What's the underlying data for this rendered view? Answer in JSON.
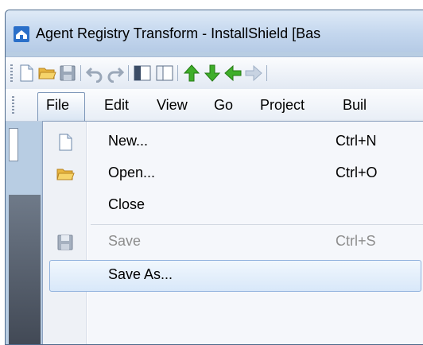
{
  "window": {
    "title": "Agent Registry Transform - InstallShield [Bas"
  },
  "toolbar": {
    "buttons": [
      "new-icon",
      "open-folder-icon",
      "save-icon",
      "undo-icon",
      "redo-icon",
      "panel-left-icon",
      "panel-right-icon",
      "arrow-up-icon",
      "arrow-down-icon",
      "arrow-left-icon",
      "arrow-right-icon"
    ]
  },
  "menubar": {
    "items": [
      {
        "label": "File"
      },
      {
        "label": "Edit"
      },
      {
        "label": "View"
      },
      {
        "label": "Go"
      },
      {
        "label": "Project"
      },
      {
        "label": "Buil"
      }
    ]
  },
  "file_menu": {
    "items": [
      {
        "label": "New...",
        "shortcut": "Ctrl+N",
        "icon": "new-file-icon",
        "enabled": true
      },
      {
        "label": "Open...",
        "shortcut": "Ctrl+O",
        "icon": "open-folder-icon",
        "enabled": true
      },
      {
        "label": "Close",
        "shortcut": "",
        "icon": "",
        "enabled": true
      },
      {
        "label": "Save",
        "shortcut": "Ctrl+S",
        "icon": "save-disk-icon",
        "enabled": false
      },
      {
        "label": "Save As...",
        "shortcut": "",
        "icon": "",
        "enabled": true,
        "hovered": true
      }
    ]
  },
  "colors": {
    "accent": "#2a6fc9",
    "menu_hover": "#d8e8f9",
    "disabled_text": "#8d8d8d"
  }
}
